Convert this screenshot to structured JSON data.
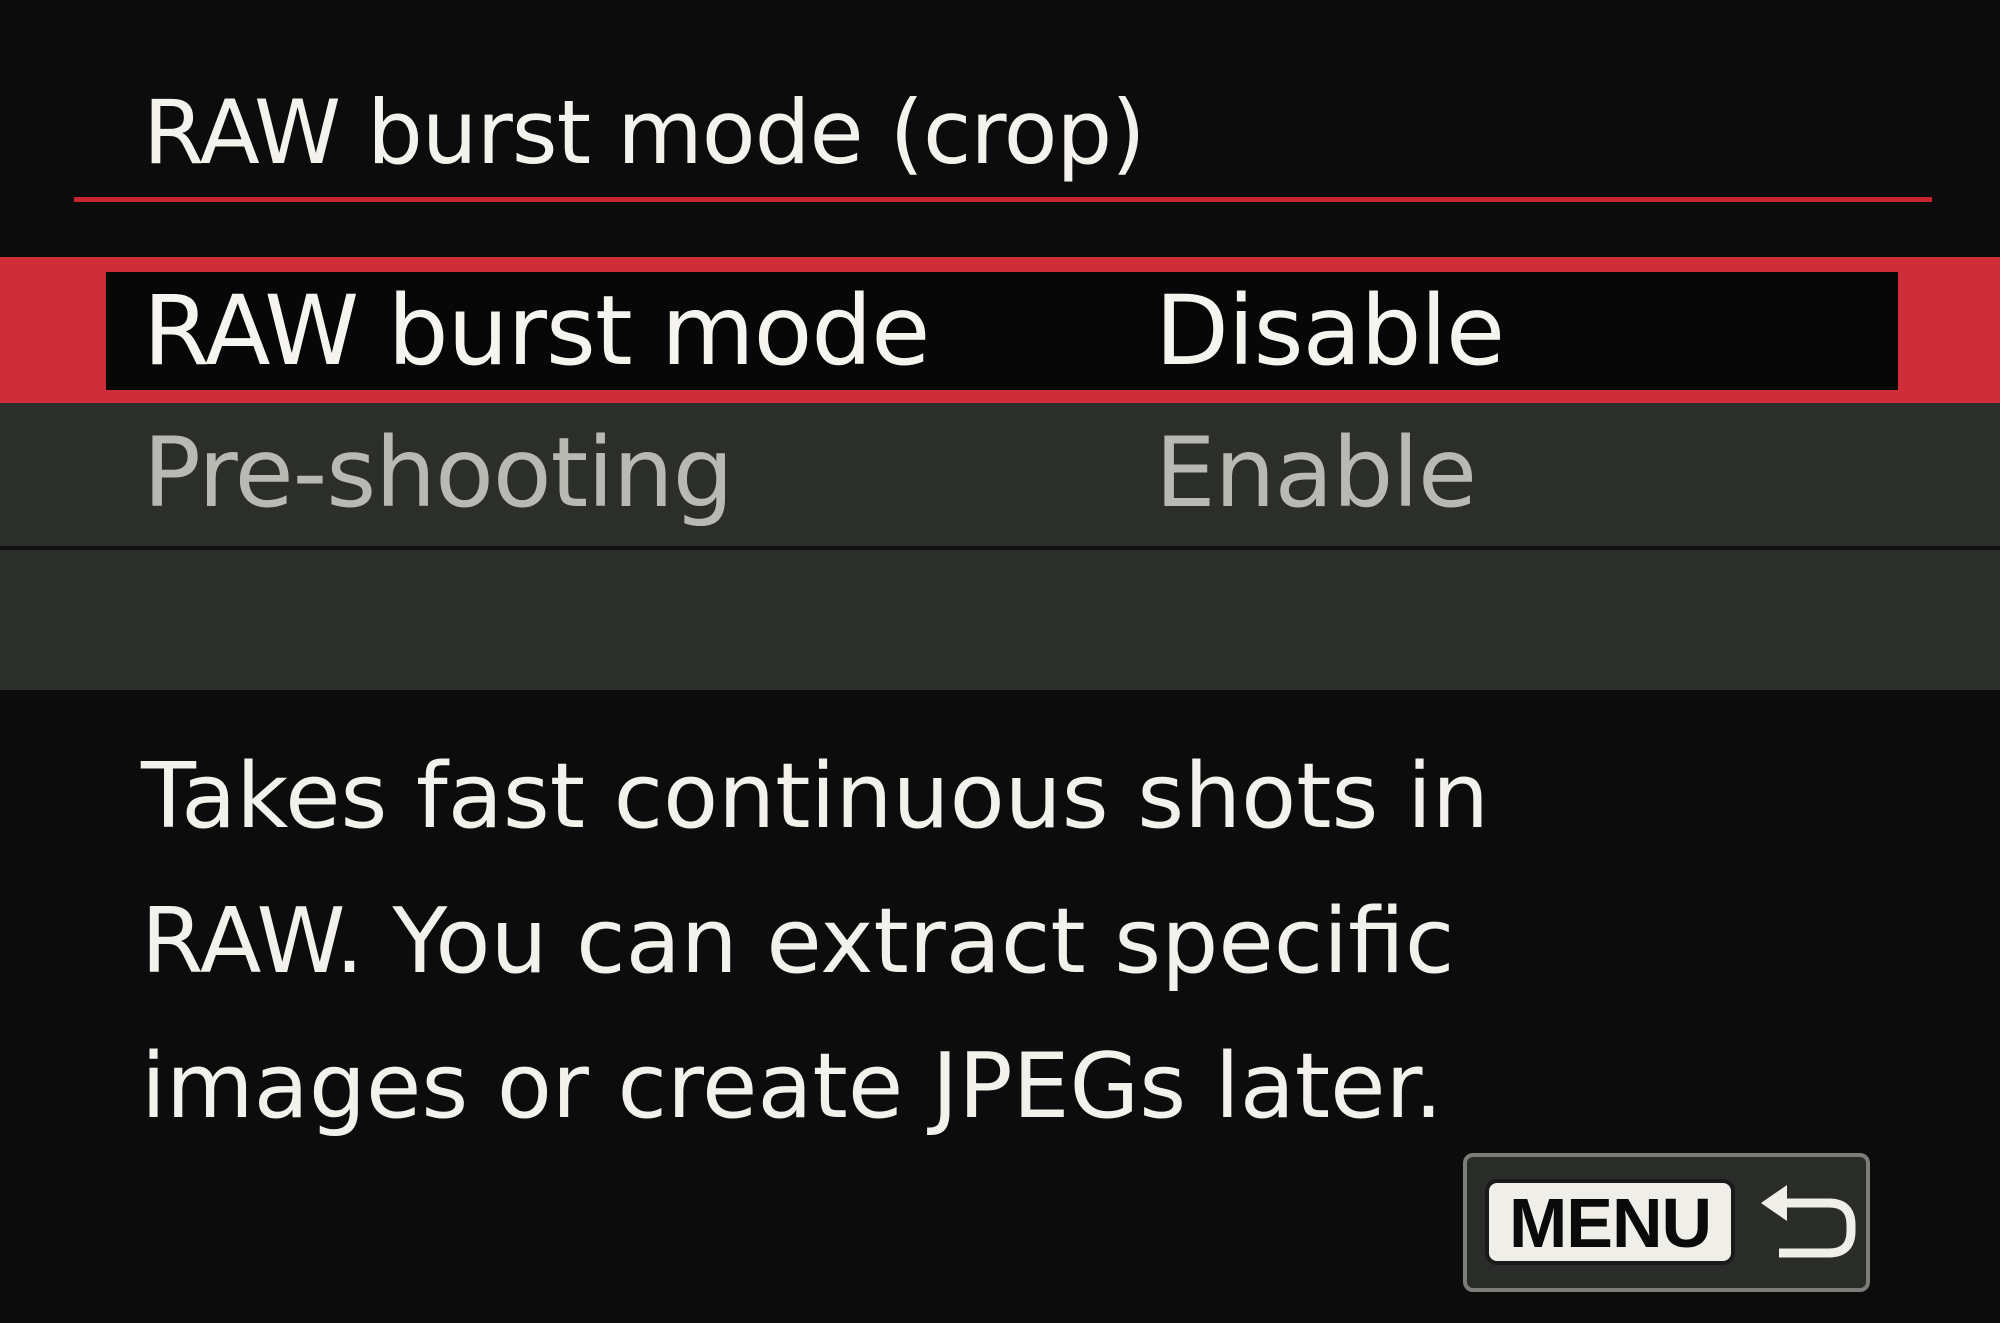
{
  "screen": {
    "title": "RAW burst mode (crop)",
    "accent_color": "#c8262e",
    "items": [
      {
        "label": "RAW burst mode",
        "value": "Disable",
        "selected": true
      },
      {
        "label": "Pre-shooting",
        "value": "Enable",
        "selected": false
      }
    ],
    "description_lines": [
      "Takes fast continuous shots in",
      "RAW. You can extract specific",
      "images or create JPEGs later."
    ],
    "back_button": {
      "key_label": "MENU",
      "icon": "return-arrow-icon"
    }
  }
}
